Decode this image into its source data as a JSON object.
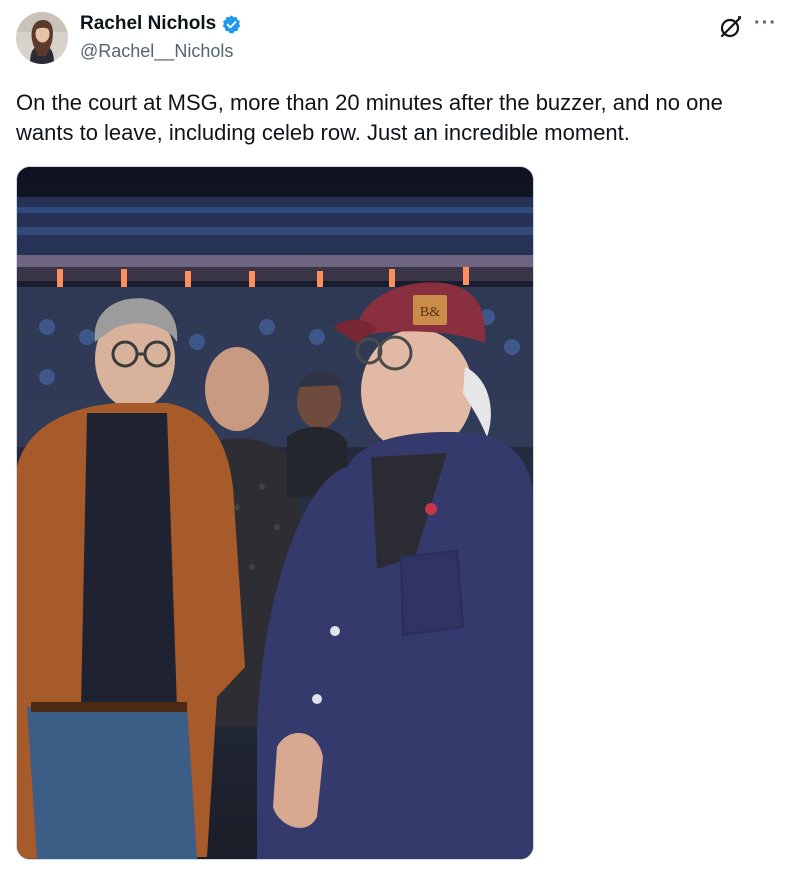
{
  "author": {
    "display_name": "Rachel Nichols",
    "handle": "@Rachel__Nichols",
    "verified": true,
    "verified_color": "#1d9bf0"
  },
  "tweet": {
    "text": "On the court at MSG,  more than 20 minutes after the buzzer,  and no one wants to leave, including celeb row. Just an incredible moment."
  },
  "icons": {
    "grok": "grok-icon",
    "more": "more-icon",
    "verified": "verified-badge-icon"
  },
  "actions": {
    "more_label": "···"
  },
  "media": {
    "cap_logo": "B&"
  },
  "colors": {
    "text_primary": "#0f1419",
    "text_secondary": "#536471",
    "border": "#cfd9de"
  }
}
